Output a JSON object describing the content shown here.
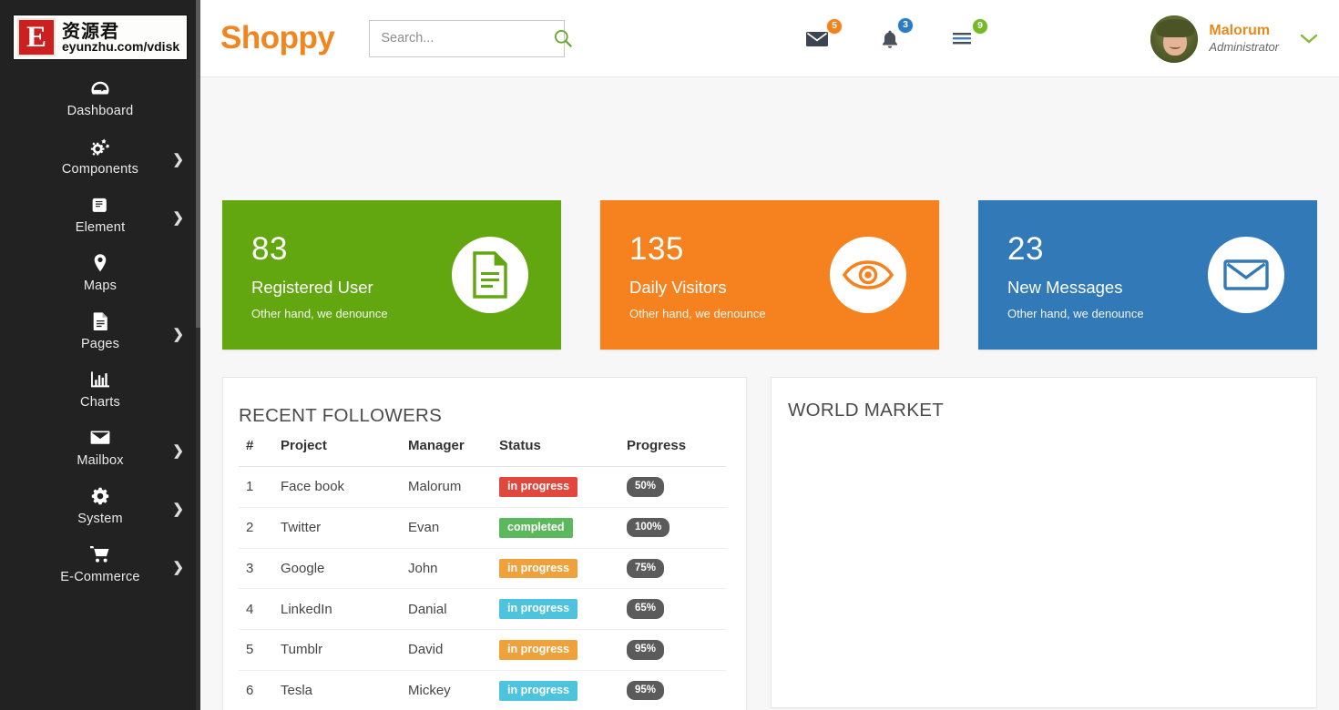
{
  "sidebar": {
    "logo": {
      "letter": "E",
      "cn": "资源君",
      "url": "eyunzhu.com/vdisk"
    },
    "items": [
      {
        "label": "Dashboard",
        "icon": "dashboard-icon",
        "caret": ""
      },
      {
        "label": "Components",
        "icon": "gears-icon",
        "caret": "❯"
      },
      {
        "label": "Element",
        "icon": "book-icon",
        "caret": "❯"
      },
      {
        "label": "Maps",
        "icon": "map-pin-icon",
        "caret": ""
      },
      {
        "label": "Pages",
        "icon": "document-icon",
        "caret": "❯"
      },
      {
        "label": "Charts",
        "icon": "bar-chart-icon",
        "caret": ""
      },
      {
        "label": "Mailbox",
        "icon": "envelope-icon",
        "caret": "❯"
      },
      {
        "label": "System",
        "icon": "gear-icon",
        "caret": "❯"
      },
      {
        "label": "E-Commerce",
        "icon": "cart-icon",
        "caret": "❯"
      }
    ]
  },
  "header": {
    "brand": "Shoppy",
    "search": {
      "placeholder": "Search...",
      "value": ""
    },
    "icons": [
      {
        "name": "mail-icon",
        "badge": "5",
        "badge_color": "#f0831e"
      },
      {
        "name": "bell-icon",
        "badge": "3",
        "badge_color": "#2b7cc4"
      },
      {
        "name": "tasks-icon",
        "badge": "9",
        "badge_color": "#76b82a"
      }
    ],
    "profile": {
      "name": "Malorum",
      "role": "Administrator",
      "caret": "⌄"
    }
  },
  "cards": [
    {
      "number": "83",
      "title": "Registered User",
      "subtitle": "Other hand, we denounce",
      "color": "#62a70f",
      "icon": "file-text-icon"
    },
    {
      "number": "135",
      "title": "Daily Visitors",
      "subtitle": "Other hand, we denounce",
      "color": "#f5821f",
      "icon": "eye-icon"
    },
    {
      "number": "23",
      "title": "New Messages",
      "subtitle": "Other hand, we denounce",
      "color": "#3279b7",
      "icon": "envelope-icon"
    }
  ],
  "followers": {
    "title": "RECENT FOLLOWERS",
    "columns": [
      "#",
      "Project",
      "Manager",
      "Status",
      "Progress"
    ],
    "rows": [
      {
        "num": "1",
        "project": "Face book",
        "manager": "Malorum",
        "status": "in progress",
        "status_color": "#e0483e",
        "progress": "50%"
      },
      {
        "num": "2",
        "project": "Twitter",
        "manager": "Evan",
        "status": "completed",
        "status_color": "#5cb85c",
        "progress": "100%"
      },
      {
        "num": "3",
        "project": "Google",
        "manager": "John",
        "status": "in progress",
        "status_color": "#efa23c",
        "progress": "75%"
      },
      {
        "num": "4",
        "project": "LinkedIn",
        "manager": "Danial",
        "status": "in progress",
        "status_color": "#4ec3de",
        "progress": "65%"
      },
      {
        "num": "5",
        "project": "Tumblr",
        "manager": "David",
        "status": "in progress",
        "status_color": "#efa23c",
        "progress": "95%"
      },
      {
        "num": "6",
        "project": "Tesla",
        "manager": "Mickey",
        "status": "in progress",
        "status_color": "#4ec3de",
        "progress": "95%"
      }
    ]
  },
  "world_market": {
    "title": "WORLD MARKET"
  }
}
